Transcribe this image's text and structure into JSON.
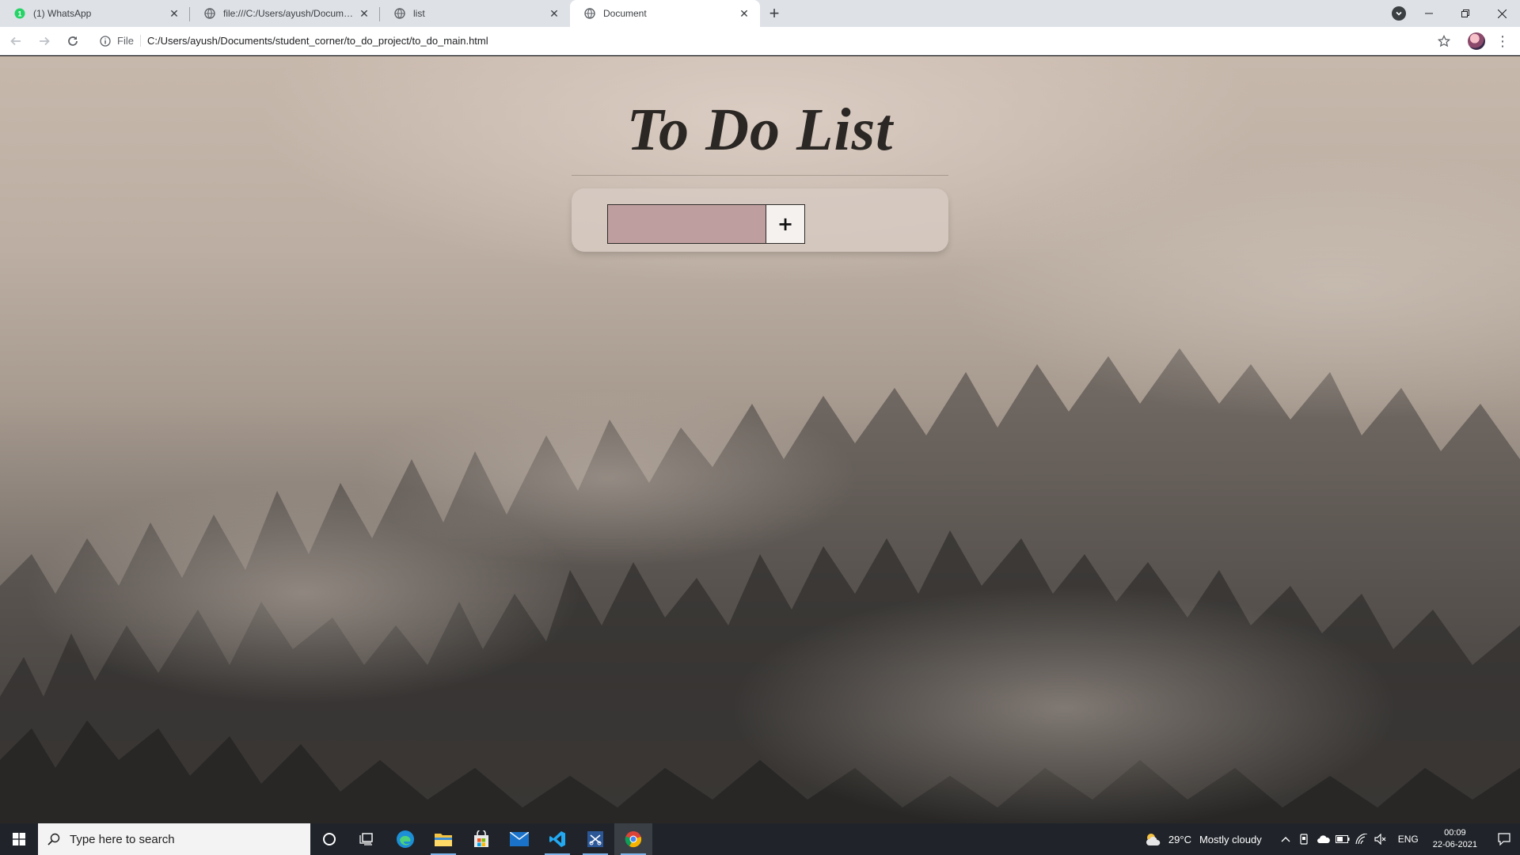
{
  "browser": {
    "tabs": [
      {
        "title": "(1) WhatsApp",
        "icon": "whatsapp-icon",
        "active": false
      },
      {
        "title": "file:///C:/Users/ayush/Documents/",
        "icon": "globe-icon",
        "active": false
      },
      {
        "title": "list",
        "icon": "globe-icon",
        "active": false
      },
      {
        "title": "Document",
        "icon": "globe-icon",
        "active": true
      }
    ],
    "new_tab": "+",
    "address": {
      "scheme": "File",
      "url": "C:/Users/ayush/Documents/student_corner/to_do_project/to_do_main.html"
    }
  },
  "page": {
    "title": "To Do List",
    "input": {
      "value": "",
      "placeholder": ""
    },
    "add_label": "+"
  },
  "taskbar": {
    "search_placeholder": "Type here to search",
    "weather": {
      "temp": "29°C",
      "condition": "Mostly cloudy"
    },
    "lang": "ENG",
    "time": "00:09",
    "date": "22-06-2021"
  },
  "colors": {
    "input_bg": "#bf9e9f",
    "card_bg": "#d6cac2",
    "taskbar_bg": "#20242a",
    "tabstrip_bg": "#dee1e6"
  }
}
